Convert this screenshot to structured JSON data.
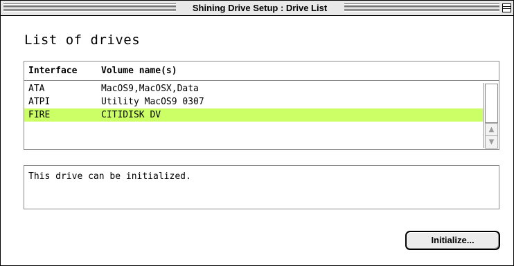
{
  "window": {
    "title": "Shining Drive Setup : Drive List"
  },
  "main": {
    "heading": "List of drives",
    "columns": [
      "Interface",
      "Volume name(s)"
    ],
    "rows": [
      {
        "interface": "ATA",
        "volumes": "MacOS9,MacOSX,Data"
      },
      {
        "interface": "ATPI",
        "volumes": "Utility MacOS9 0307"
      },
      {
        "interface": "FIRE",
        "volumes": "CITIDISK DV"
      }
    ],
    "selected_row_color": "#ccff66",
    "status_message": "This drive can be initialized.",
    "initialize_button": "Initialize..."
  },
  "icons": {
    "scroll_up": "scroll-up-arrow-icon",
    "scroll_down": "scroll-down-arrow-icon",
    "collapse": "window-collapse-box-icon"
  }
}
